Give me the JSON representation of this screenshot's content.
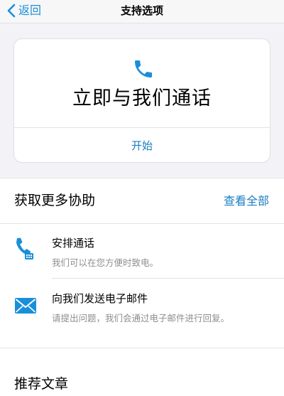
{
  "navbar": {
    "back_label": "返回",
    "title": "支持选项"
  },
  "call_card": {
    "icon": "phone-icon",
    "title": "立即与我们通话",
    "start_label": "开始"
  },
  "help": {
    "title": "获取更多协助",
    "see_all_label": "查看全部",
    "items": [
      {
        "icon": "scheduled-call-icon",
        "title": "安排通话",
        "subtitle": "我们可以在您方便时致电。"
      },
      {
        "icon": "mail-icon",
        "title": "向我们发送电子邮件",
        "subtitle": "请提出问题，我们会通过电子邮件进行回复。"
      }
    ]
  },
  "articles": {
    "title": "推荐文章"
  },
  "colors": {
    "accent": "#1a8fd9",
    "link": "#1a7ec2",
    "secondary_text": "#8e8e93",
    "background": "#f2f2f7"
  }
}
